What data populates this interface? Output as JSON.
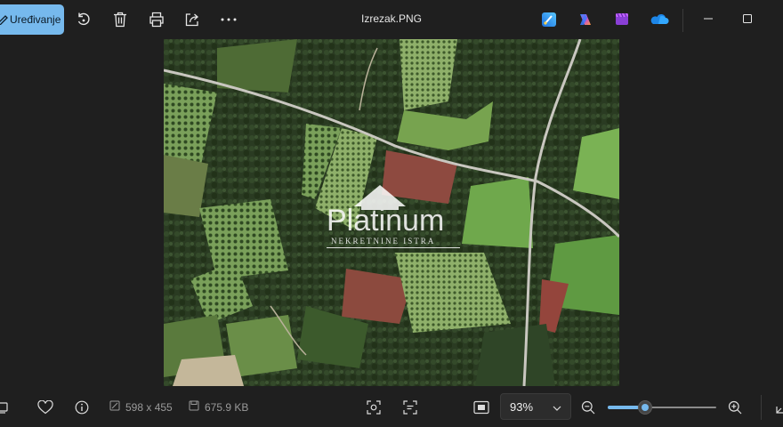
{
  "toolbar": {
    "edit_label": "Uređivanje",
    "icons": [
      "rotate-icon",
      "delete-icon",
      "print-icon",
      "share-icon",
      "more-icon"
    ]
  },
  "window": {
    "title": "Izrezak.PNG"
  },
  "apps": [
    "paint-icon",
    "copilot-icon",
    "clipchamp-icon",
    "onedrive-icon"
  ],
  "image": {
    "watermark_brand": "Platinum",
    "watermark_tagline": "NEKRETNINE ISTRA"
  },
  "status": {
    "dimensions": "598 x 455",
    "file_size": "675.9 KB"
  },
  "zoom": {
    "level_label": "93%",
    "level": 0.93
  },
  "colors": {
    "accent": "#76b9ed",
    "background": "#1f1f1f"
  }
}
